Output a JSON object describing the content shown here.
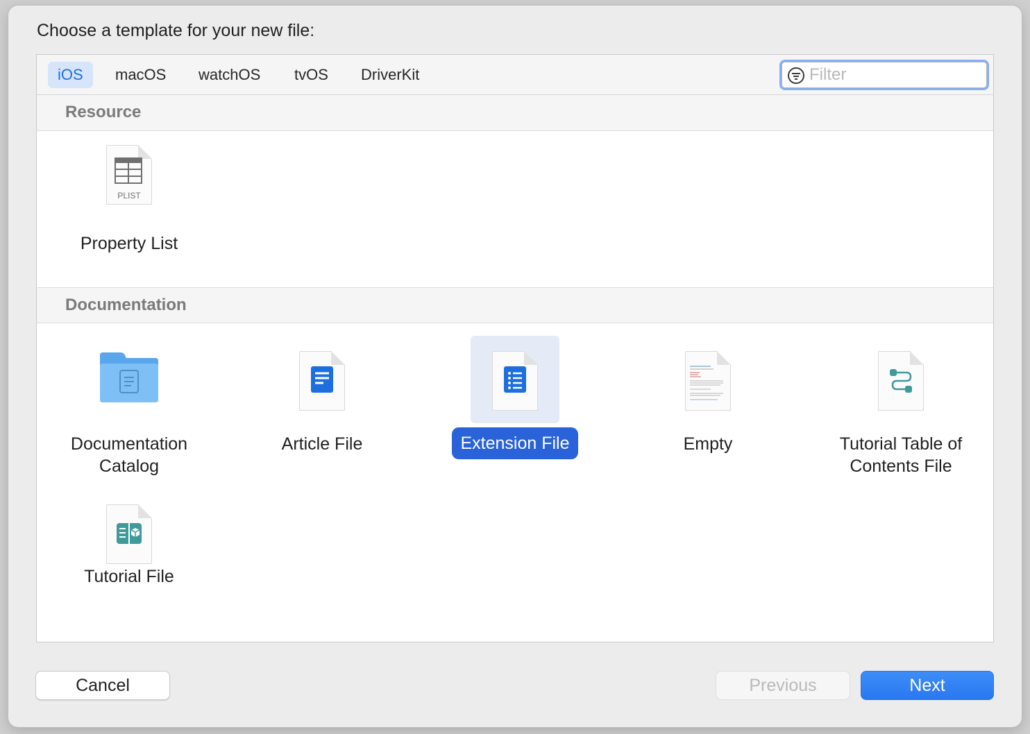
{
  "dialog": {
    "title": "Choose a template for your new file:"
  },
  "platform_tabs": [
    {
      "label": "iOS",
      "selected": true
    },
    {
      "label": "macOS",
      "selected": false
    },
    {
      "label": "watchOS",
      "selected": false
    },
    {
      "label": "tvOS",
      "selected": false
    },
    {
      "label": "DriverKit",
      "selected": false
    }
  ],
  "filter": {
    "placeholder": "Filter",
    "value": ""
  },
  "sections": [
    {
      "header": "Resource",
      "items": [
        {
          "label": "Property List",
          "icon": "plist-document-icon",
          "icon_text": "PLIST",
          "selected": false
        }
      ]
    },
    {
      "header": "Documentation",
      "items": [
        {
          "label": "Documentation Catalog",
          "icon": "folder-icon",
          "selected": false
        },
        {
          "label": "Article File",
          "icon": "article-document-icon",
          "selected": false
        },
        {
          "label": "Extension File",
          "icon": "extension-document-icon",
          "selected": true
        },
        {
          "label": "Empty",
          "icon": "empty-document-icon",
          "selected": false
        },
        {
          "label": "Tutorial Table of Contents File",
          "icon": "tutorial-toc-document-icon",
          "selected": false
        },
        {
          "label": "Tutorial File",
          "icon": "tutorial-document-icon",
          "selected": false
        }
      ]
    }
  ],
  "buttons": {
    "cancel": "Cancel",
    "previous": "Previous",
    "next": "Next"
  },
  "colors": {
    "accent": "#2a63d9",
    "tab_selected_bg": "#d6e5fb",
    "next_button": "#3584f5",
    "folder": "#62aef0"
  }
}
